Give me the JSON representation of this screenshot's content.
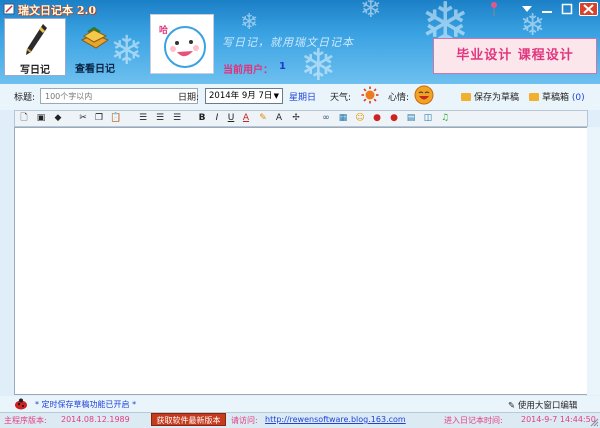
{
  "window": {
    "title": "瑞文日记本 2.0"
  },
  "header": {
    "nav": [
      {
        "label": "写日记",
        "icon": "pen-icon"
      },
      {
        "label": "查看日记",
        "icon": "book-icon"
      }
    ],
    "slogan": "写日记，就用瑞文日记本",
    "current_user_label": "当前用户：",
    "current_user": "1",
    "banner": "毕业设计 课程设计",
    "avatar_text": "哈"
  },
  "entry": {
    "title_label": "标题:",
    "title_placeholder": "100个字以内",
    "date_label": "日期:",
    "date_value": "2014年 9月 7日",
    "weekday": "星期日",
    "weather_label": "天气:",
    "mood_label": "心情:",
    "save_draft": "保存为草稿",
    "draft_box": "草稿箱",
    "draft_count": "(0)"
  },
  "status": {
    "autosave": "* 定时保存草稿功能已开启 *",
    "big_window": "使用大窗口编辑"
  },
  "footer": {
    "version_label": "主程序版本:",
    "version": "2014.08.12.1989",
    "latest_button": "获取软件最新版本",
    "visit_label": "请访问:",
    "visit_url": "http://rewensoftware.blog.163.com",
    "login_label": "进入日记本时间:",
    "login_time": "2014-9-7 14:44:50"
  },
  "colors": {
    "accent_pink": "#e33d84",
    "link_blue": "#1f43d8",
    "header_blue": "#3aa2e2"
  }
}
